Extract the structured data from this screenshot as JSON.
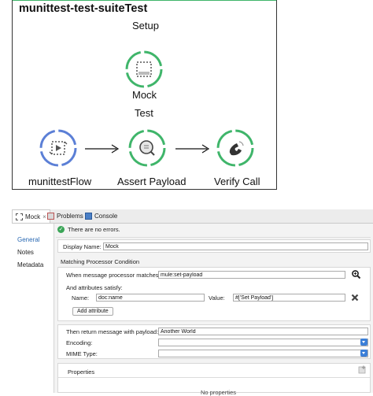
{
  "flow": {
    "title": "munittest-test-suiteTest",
    "setup_label": "Setup",
    "test_label": "Test",
    "nodes": {
      "mock": "Mock",
      "flow_ref": "munittestFlow",
      "assert": "Assert Payload",
      "verify": "Verify Call"
    },
    "colors": {
      "green": "#3fb56a",
      "blue": "#5b7fd6"
    }
  },
  "tabs": {
    "mock": "Mock",
    "close": "×",
    "problems": "Problems",
    "console": "Console"
  },
  "sidenav": {
    "general": "General",
    "notes": "Notes",
    "metadata": "Metadata"
  },
  "status": {
    "message": "There are no errors."
  },
  "form": {
    "display_name_label": "Display Name:",
    "display_name_value": "Mock",
    "matching_title": "Matching Processor Condition",
    "when_label": "When message processor matches:",
    "when_value": "mule:set-payload",
    "attributes_label": "And attributes satisfy:",
    "name_label": "Name:",
    "name_value": "doc:name",
    "value_label": "Value:",
    "value_value": "#['Set Payload']",
    "add_attribute": "Add attribute",
    "then_label": "Then return message with payload:",
    "then_value": "Another World",
    "encoding_label": "Encoding:",
    "mime_label": "MIME Type:",
    "properties_label": "Properties",
    "no_properties": "No properties"
  }
}
